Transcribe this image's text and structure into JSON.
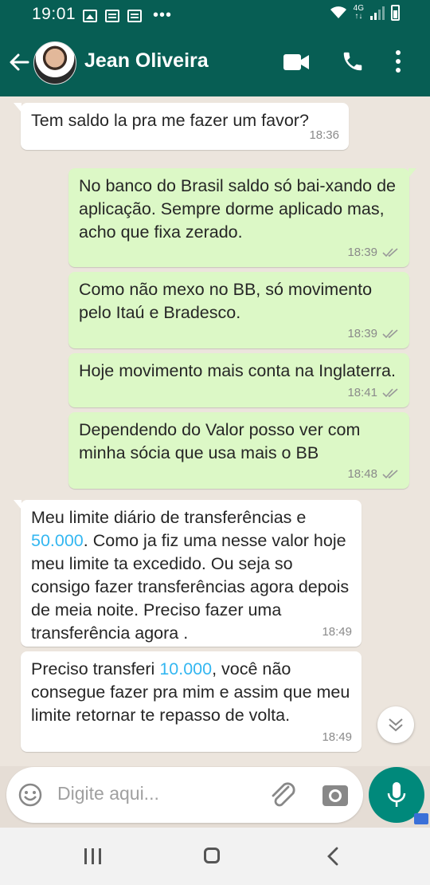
{
  "status_bar": {
    "time": "19:01",
    "network": "4G"
  },
  "header": {
    "contact_name": "Jean Oliveira"
  },
  "messages": [
    {
      "direction": "in",
      "text": "Tem saldo la pra me fazer um favor?",
      "time": "18:36"
    },
    {
      "direction": "out",
      "text": "No banco do Brasil saldo só bai-xando de aplicação. Sempre dorme aplicado mas, acho que fixa zerado.",
      "time": "18:39"
    },
    {
      "direction": "out",
      "text": "Como não mexo no BB, só movimento pelo Itaú e Bradesco.",
      "time": "18:39"
    },
    {
      "direction": "out",
      "text": "Hoje movimento mais conta na Inglaterra.",
      "time": "18:41"
    },
    {
      "direction": "out",
      "text": "Dependendo do Valor posso ver com minha sócia que usa mais o BB",
      "time": "18:48"
    },
    {
      "direction": "in",
      "text_before": "Meu limite diário de transferências e ",
      "highlight": "50.000",
      "text_after": ". Como ja fiz uma nesse valor hoje meu limite ta excedido. Ou seja so consigo fazer transferências agora depois de meia noite. Preciso fazer uma transferência agora .",
      "time": "18:49"
    },
    {
      "direction": "in",
      "text_before": "Preciso transferi ",
      "highlight": "10.000",
      "text_after": ", você não consegue fazer pra mim e assim que meu limite retornar te repasso de volta.",
      "time": "18:49"
    }
  ],
  "input": {
    "placeholder": "Digite aqui..."
  },
  "colors": {
    "header": "#075e54",
    "outgoing": "#dcf8c6",
    "incoming": "#ffffff",
    "mic": "#00897b",
    "link": "#34b7f1"
  },
  "icons": [
    "image-icon",
    "message-icon",
    "back-arrow-icon",
    "video-call-icon",
    "phone-icon",
    "menu-icon",
    "double-check-icon",
    "scroll-down-icon",
    "emoji-icon",
    "attach-icon",
    "camera-icon",
    "mic-icon"
  ]
}
